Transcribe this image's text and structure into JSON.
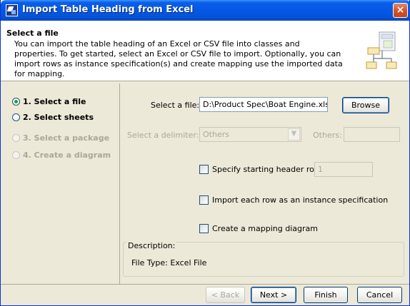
{
  "window": {
    "title": "Import Table Heading from Excel",
    "close_icon": "×"
  },
  "header": {
    "title": "Select a file",
    "description": "You can import the table heading of an Excel or CSV file into classes and properties. To get started, select an Excel or CSV file to import. Optionally, you can import rows as instance specification(s) and create mapping use the imported data for mapping."
  },
  "steps": [
    {
      "label": "1. Select a file",
      "state": "selected"
    },
    {
      "label": "2. Select sheets",
      "state": "enabled"
    },
    {
      "label": "3. Select a package",
      "state": "disabled"
    },
    {
      "label": "4. Create a diagram",
      "state": "disabled"
    }
  ],
  "form": {
    "file_label": "Select a file:",
    "file_value": "D:\\Product Spec\\Boat Engine.xls",
    "browse_label": "Browse",
    "delimiter_label": "Select a delimiter:",
    "delimiter_value": "Others",
    "others_label": "Others:",
    "others_value": "",
    "header_row_label": "Specify starting header row",
    "header_row_value": "1",
    "import_rows_label": "Import each row as an instance specification",
    "mapping_label": "Create a mapping diagram"
  },
  "description_group": {
    "title": "Description:",
    "text": "File Type: Excel File"
  },
  "footer": {
    "back_label": "< Back",
    "next_label": "Next >",
    "finish_label": "Finish",
    "cancel_label": "Cancel"
  }
}
